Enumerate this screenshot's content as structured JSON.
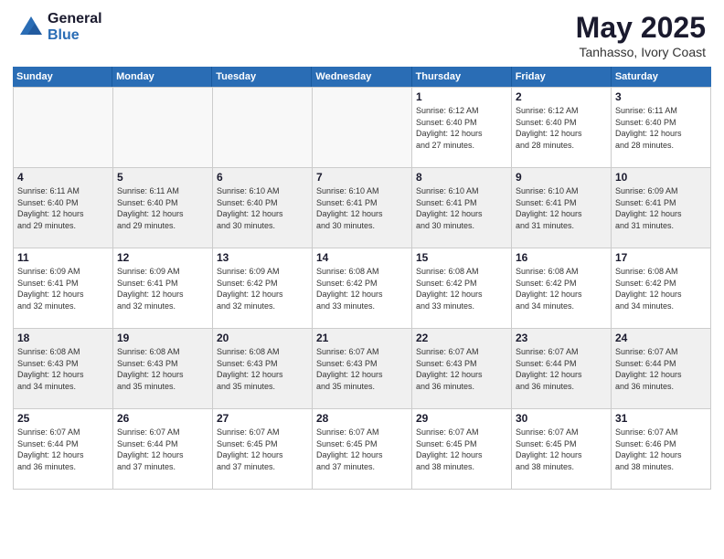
{
  "header": {
    "logo_general": "General",
    "logo_blue": "Blue",
    "main_title": "May 2025",
    "subtitle": "Tanhasso, Ivory Coast"
  },
  "weekdays": [
    "Sunday",
    "Monday",
    "Tuesday",
    "Wednesday",
    "Thursday",
    "Friday",
    "Saturday"
  ],
  "rows": [
    [
      {
        "day": "",
        "empty": true
      },
      {
        "day": "",
        "empty": true
      },
      {
        "day": "",
        "empty": true
      },
      {
        "day": "",
        "empty": true
      },
      {
        "day": "1",
        "info": "Sunrise: 6:12 AM\nSunset: 6:40 PM\nDaylight: 12 hours\nand 27 minutes."
      },
      {
        "day": "2",
        "info": "Sunrise: 6:12 AM\nSunset: 6:40 PM\nDaylight: 12 hours\nand 28 minutes."
      },
      {
        "day": "3",
        "info": "Sunrise: 6:11 AM\nSunset: 6:40 PM\nDaylight: 12 hours\nand 28 minutes."
      }
    ],
    [
      {
        "day": "4",
        "info": "Sunrise: 6:11 AM\nSunset: 6:40 PM\nDaylight: 12 hours\nand 29 minutes."
      },
      {
        "day": "5",
        "info": "Sunrise: 6:11 AM\nSunset: 6:40 PM\nDaylight: 12 hours\nand 29 minutes."
      },
      {
        "day": "6",
        "info": "Sunrise: 6:10 AM\nSunset: 6:40 PM\nDaylight: 12 hours\nand 30 minutes."
      },
      {
        "day": "7",
        "info": "Sunrise: 6:10 AM\nSunset: 6:41 PM\nDaylight: 12 hours\nand 30 minutes."
      },
      {
        "day": "8",
        "info": "Sunrise: 6:10 AM\nSunset: 6:41 PM\nDaylight: 12 hours\nand 30 minutes."
      },
      {
        "day": "9",
        "info": "Sunrise: 6:10 AM\nSunset: 6:41 PM\nDaylight: 12 hours\nand 31 minutes."
      },
      {
        "day": "10",
        "info": "Sunrise: 6:09 AM\nSunset: 6:41 PM\nDaylight: 12 hours\nand 31 minutes."
      }
    ],
    [
      {
        "day": "11",
        "info": "Sunrise: 6:09 AM\nSunset: 6:41 PM\nDaylight: 12 hours\nand 32 minutes."
      },
      {
        "day": "12",
        "info": "Sunrise: 6:09 AM\nSunset: 6:41 PM\nDaylight: 12 hours\nand 32 minutes."
      },
      {
        "day": "13",
        "info": "Sunrise: 6:09 AM\nSunset: 6:42 PM\nDaylight: 12 hours\nand 32 minutes."
      },
      {
        "day": "14",
        "info": "Sunrise: 6:08 AM\nSunset: 6:42 PM\nDaylight: 12 hours\nand 33 minutes."
      },
      {
        "day": "15",
        "info": "Sunrise: 6:08 AM\nSunset: 6:42 PM\nDaylight: 12 hours\nand 33 minutes."
      },
      {
        "day": "16",
        "info": "Sunrise: 6:08 AM\nSunset: 6:42 PM\nDaylight: 12 hours\nand 34 minutes."
      },
      {
        "day": "17",
        "info": "Sunrise: 6:08 AM\nSunset: 6:42 PM\nDaylight: 12 hours\nand 34 minutes."
      }
    ],
    [
      {
        "day": "18",
        "info": "Sunrise: 6:08 AM\nSunset: 6:43 PM\nDaylight: 12 hours\nand 34 minutes."
      },
      {
        "day": "19",
        "info": "Sunrise: 6:08 AM\nSunset: 6:43 PM\nDaylight: 12 hours\nand 35 minutes."
      },
      {
        "day": "20",
        "info": "Sunrise: 6:08 AM\nSunset: 6:43 PM\nDaylight: 12 hours\nand 35 minutes."
      },
      {
        "day": "21",
        "info": "Sunrise: 6:07 AM\nSunset: 6:43 PM\nDaylight: 12 hours\nand 35 minutes."
      },
      {
        "day": "22",
        "info": "Sunrise: 6:07 AM\nSunset: 6:43 PM\nDaylight: 12 hours\nand 36 minutes."
      },
      {
        "day": "23",
        "info": "Sunrise: 6:07 AM\nSunset: 6:44 PM\nDaylight: 12 hours\nand 36 minutes."
      },
      {
        "day": "24",
        "info": "Sunrise: 6:07 AM\nSunset: 6:44 PM\nDaylight: 12 hours\nand 36 minutes."
      }
    ],
    [
      {
        "day": "25",
        "info": "Sunrise: 6:07 AM\nSunset: 6:44 PM\nDaylight: 12 hours\nand 36 minutes."
      },
      {
        "day": "26",
        "info": "Sunrise: 6:07 AM\nSunset: 6:44 PM\nDaylight: 12 hours\nand 37 minutes."
      },
      {
        "day": "27",
        "info": "Sunrise: 6:07 AM\nSunset: 6:45 PM\nDaylight: 12 hours\nand 37 minutes."
      },
      {
        "day": "28",
        "info": "Sunrise: 6:07 AM\nSunset: 6:45 PM\nDaylight: 12 hours\nand 37 minutes."
      },
      {
        "day": "29",
        "info": "Sunrise: 6:07 AM\nSunset: 6:45 PM\nDaylight: 12 hours\nand 38 minutes."
      },
      {
        "day": "30",
        "info": "Sunrise: 6:07 AM\nSunset: 6:45 PM\nDaylight: 12 hours\nand 38 minutes."
      },
      {
        "day": "31",
        "info": "Sunrise: 6:07 AM\nSunset: 6:46 PM\nDaylight: 12 hours\nand 38 minutes."
      }
    ]
  ]
}
